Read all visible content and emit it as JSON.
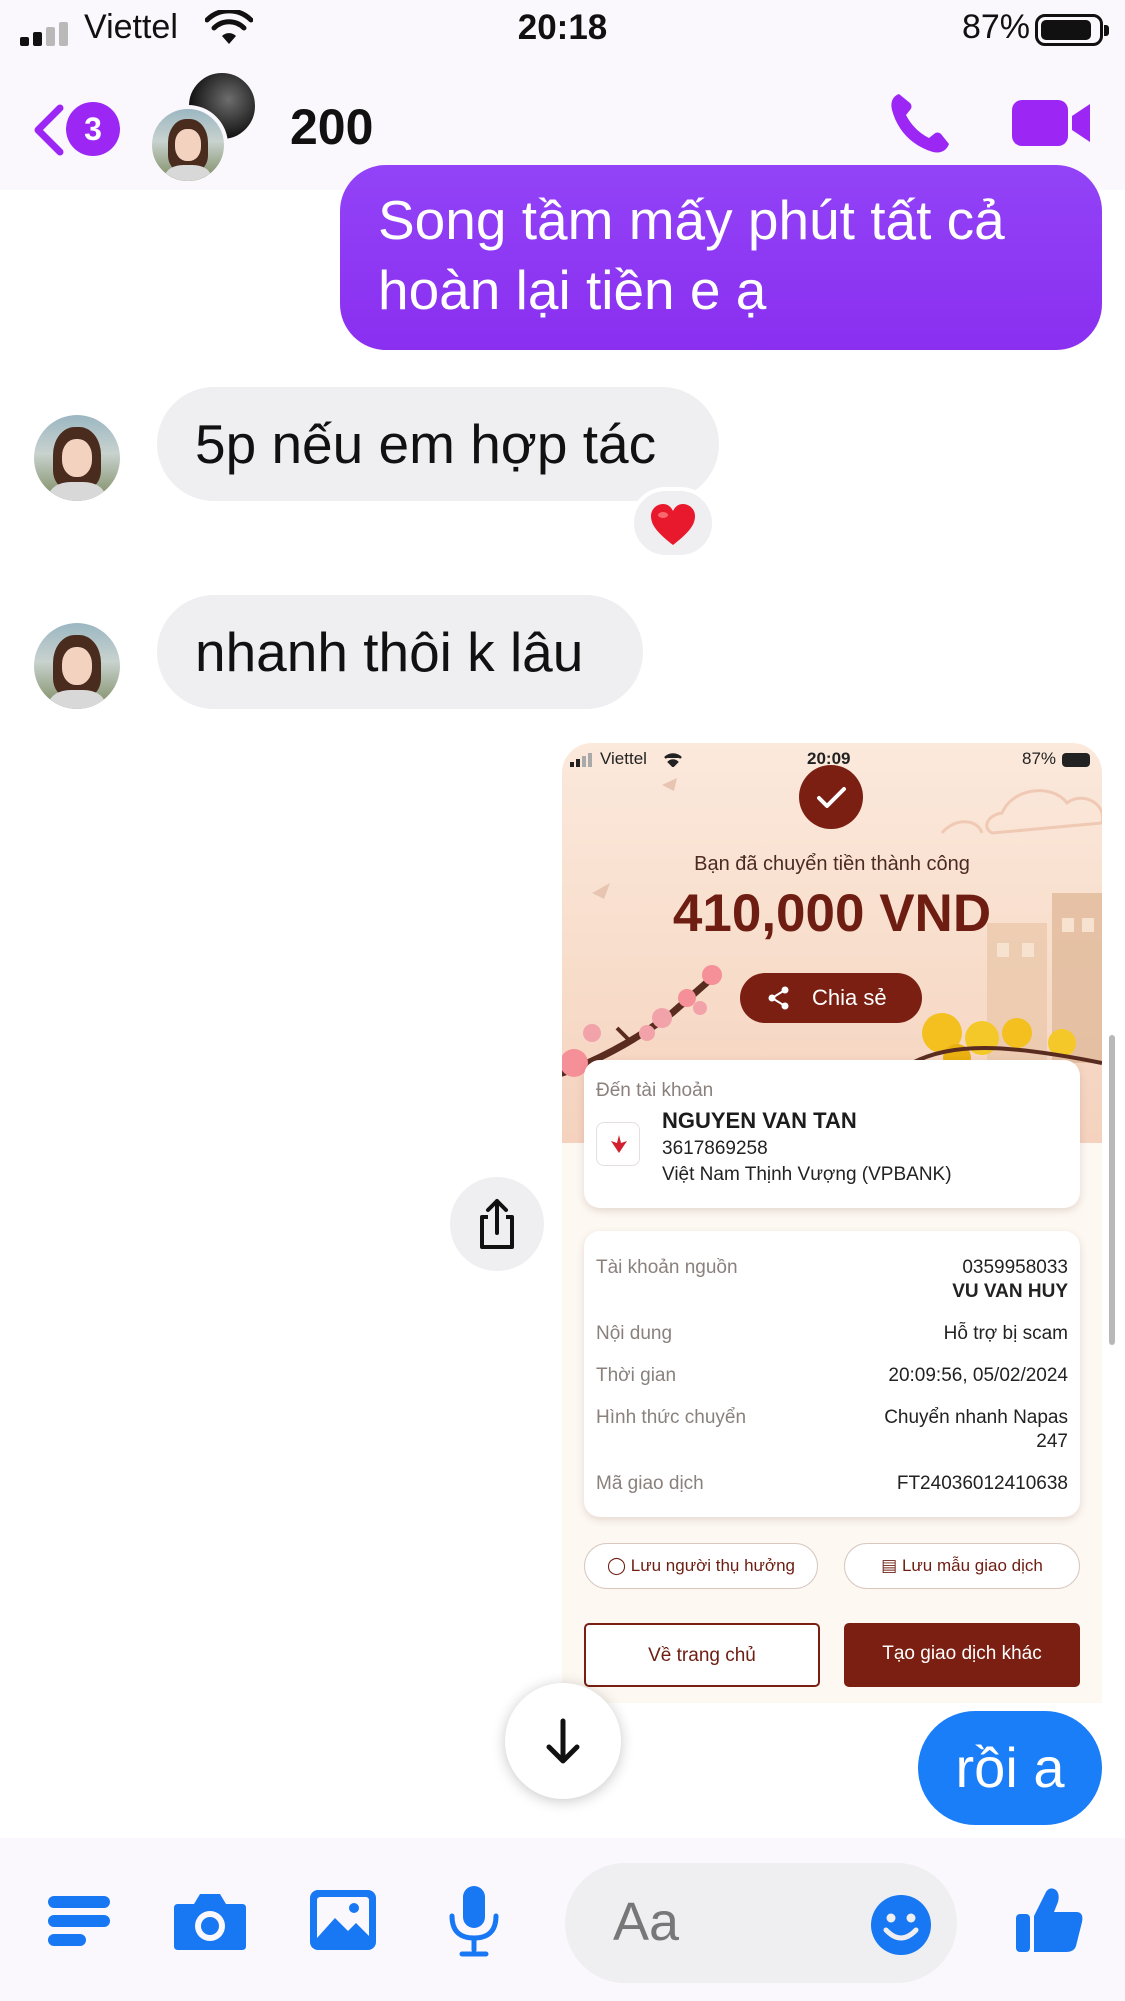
{
  "status_bar": {
    "carrier": "Viettel",
    "time": "20:18",
    "battery": "87%"
  },
  "header": {
    "unread_count": "3",
    "title": "200"
  },
  "messages": [
    {
      "direction": "outgoing",
      "text": "Song tầm mấy phút tất cả hoàn lại tiền e ạ"
    },
    {
      "direction": "incoming",
      "text": "5p nếu em hợp tác",
      "reaction": "heart"
    },
    {
      "direction": "incoming",
      "text": "nhanh thôi k lâu"
    },
    {
      "direction": "outgoing",
      "type": "image"
    },
    {
      "direction": "outgoing",
      "text": "rồi a"
    }
  ],
  "receipt": {
    "status_bar": {
      "carrier": "Viettel",
      "time": "20:09",
      "battery": "87%"
    },
    "success_text": "Bạn đã chuyển tiền thành công",
    "amount": "410,000 VND",
    "share_label": "Chia sẻ",
    "recipient": {
      "label": "Đến tài khoản",
      "name": "NGUYEN VAN TAN",
      "account": "3617869258",
      "bank": "Việt Nam Thịnh Vượng (VPBANK)"
    },
    "details": {
      "source_label": "Tài khoản nguồn",
      "source_account": "0359958033",
      "source_name": "VU VAN HUY",
      "content_label": "Nội dung",
      "content_value": "Hỗ trợ bị scam",
      "time_label": "Thời gian",
      "time_value": "20:09:56, 05/02/2024",
      "method_label": "Hình thức chuyển",
      "method_value_1": "Chuyển nhanh Napas",
      "method_value_2": "247",
      "txn_label": "Mã giao dịch",
      "txn_value": "FT24036012410638"
    },
    "save_beneficiary": "Lưu người thụ hưởng",
    "save_template": "Lưu mẫu giao dịch",
    "home_button": "Về trang chủ",
    "new_transaction_button": "Tạo giao dịch khác"
  },
  "composer": {
    "placeholder": "Aa"
  },
  "colors": {
    "messenger_purple": "#8a2ff0",
    "messenger_blue": "#1a7ef8",
    "composer_blue": "#1877f2",
    "receipt_brown": "#7a1f12"
  },
  "icons": [
    "back-chevron-icon",
    "phone-icon",
    "video-camera-icon",
    "heart-reaction-icon",
    "share-icon",
    "arrow-down-icon",
    "menu-icon",
    "camera-icon",
    "image-icon",
    "microphone-icon",
    "emoji-icon",
    "thumbs-up-icon"
  ]
}
